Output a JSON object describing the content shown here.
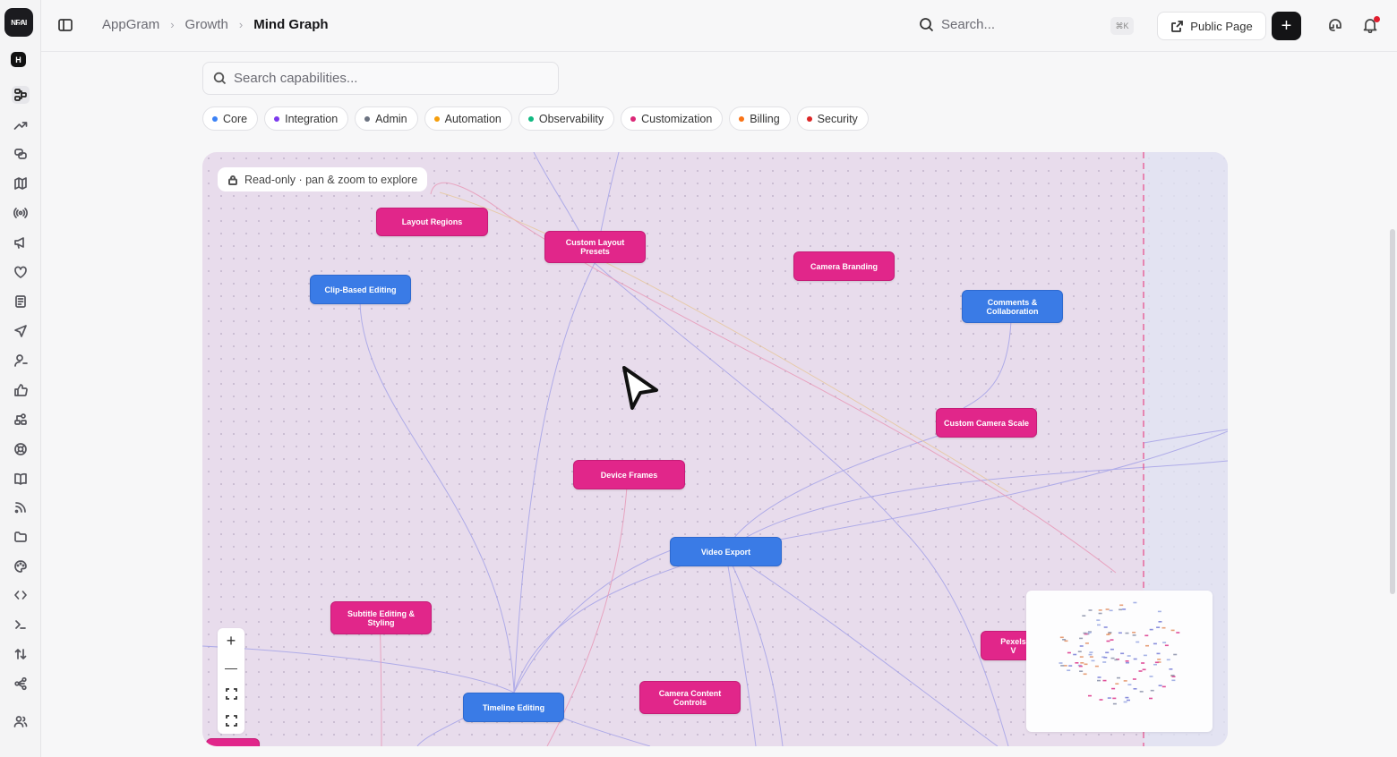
{
  "app": {
    "logo_text": "NF∕AI",
    "workspace_initial": "H"
  },
  "breadcrumb": {
    "items": [
      "AppGram",
      "Growth",
      "Mind Graph"
    ],
    "separator": "›"
  },
  "header": {
    "search_placeholder": "Search...",
    "search_shortcut": "⌘K",
    "public_page_label": "Public Page",
    "add_label": "+",
    "has_notifications": true
  },
  "capabilities": {
    "search_placeholder": "Search capabilities...",
    "filters": [
      {
        "label": "Core",
        "color": "#3b82f6"
      },
      {
        "label": "Integration",
        "color": "#7c3aed"
      },
      {
        "label": "Admin",
        "color": "#6b7280"
      },
      {
        "label": "Automation",
        "color": "#f59e0b"
      },
      {
        "label": "Observability",
        "color": "#10b981"
      },
      {
        "label": "Customization",
        "color": "#db2777"
      },
      {
        "label": "Billing",
        "color": "#f97316"
      },
      {
        "label": "Security",
        "color": "#dc2626"
      }
    ]
  },
  "graph": {
    "readonly_label": "Read-only · pan & zoom to explore",
    "nodes": [
      {
        "id": "layout-regions",
        "label": "Layout Regions",
        "category": "Customization"
      },
      {
        "id": "custom-layout-presets",
        "label": "Custom Layout Presets",
        "category": "Customization"
      },
      {
        "id": "camera-branding",
        "label": "Camera Branding",
        "category": "Customization"
      },
      {
        "id": "clip-based-editing",
        "label": "Clip-Based Editing",
        "category": "Core"
      },
      {
        "id": "comments-collaboration",
        "label": "Comments & Collaboration",
        "category": "Core"
      },
      {
        "id": "custom-camera-scale",
        "label": "Custom Camera Scale",
        "category": "Customization"
      },
      {
        "id": "device-frames",
        "label": "Device Frames",
        "category": "Customization"
      },
      {
        "id": "video-export",
        "label": "Video Export",
        "category": "Core"
      },
      {
        "id": "subtitle-editing",
        "label": "Subtitle Editing & Styling",
        "category": "Customization"
      },
      {
        "id": "timeline-editing",
        "label": "Timeline Editing",
        "category": "Core"
      },
      {
        "id": "camera-content-controls",
        "label": "Camera Content Controls",
        "category": "Customization"
      },
      {
        "id": "pexels",
        "label": "Pexels V",
        "category": "Customization"
      }
    ],
    "zoom_controls": {
      "zoom_in": "+",
      "zoom_out": "—"
    },
    "colors": {
      "core": "#3a7be6",
      "customization": "#e1268a",
      "canvas": "#e8dcec"
    }
  },
  "rail_icons": [
    "mind-graph-icon",
    "trending-icon",
    "chat-icon",
    "map-icon",
    "broadcast-icon",
    "megaphone-icon",
    "heart-icon",
    "notes-icon",
    "send-icon",
    "user-icon",
    "thumbs-up-icon",
    "flow-icon",
    "support-icon",
    "book-icon",
    "rss-icon",
    "folder-icon",
    "palette-icon",
    "code-icon",
    "terminal-icon",
    "sort-icon",
    "share-icon",
    "team-icon"
  ]
}
